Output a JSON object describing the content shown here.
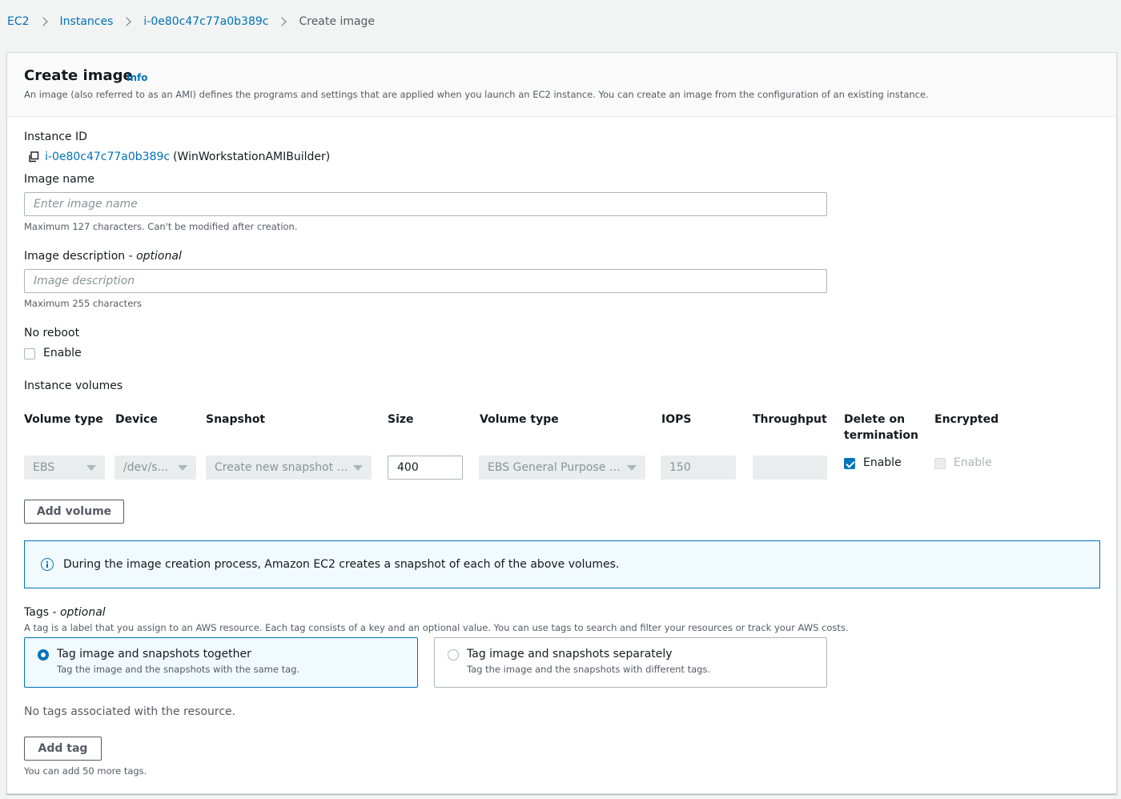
{
  "breadcrumb": {
    "items": [
      "EC2",
      "Instances",
      "i-0e80c47c77a0b389c"
    ],
    "current": "Create image"
  },
  "header": {
    "title": "Create image",
    "info": "Info",
    "description": "An image (also referred to as an AMI) defines the programs and settings that are applied when you launch an EC2 instance. You can create an image from the configuration of an existing instance."
  },
  "instance": {
    "label": "Instance ID",
    "id": "i-0e80c47c77a0b389c",
    "name": "(WinWorkstationAMIBuilder)"
  },
  "image_name": {
    "label": "Image name",
    "placeholder": "Enter image name",
    "hint": "Maximum 127 characters. Can't be modified after creation."
  },
  "image_description": {
    "label": "Image description - ",
    "label_optional": "optional",
    "placeholder": "Image description",
    "hint": "Maximum 255 characters"
  },
  "no_reboot": {
    "label": "No reboot",
    "checkbox_label": "Enable",
    "checked": false
  },
  "volumes": {
    "label": "Instance volumes",
    "columns": [
      "Volume type",
      "Device",
      "Snapshot",
      "Size",
      "Volume type",
      "IOPS",
      "Throughput",
      "Delete on termination",
      "Encrypted"
    ],
    "row": {
      "volume_type": "EBS",
      "device": "/dev/s...",
      "snapshot": "Create new snapshot fr...",
      "size": "400",
      "ebs_volume_type": "EBS General Purpose SS...",
      "iops": "150",
      "throughput": "",
      "delete_on_termination": "Enable",
      "encrypted": "Enable"
    },
    "add_button": "Add volume"
  },
  "info_alert": "During the image creation process, Amazon EC2 creates a snapshot of each of the above volumes.",
  "tags": {
    "label": "Tags - ",
    "label_optional": "optional",
    "description": "A tag is a label that you assign to an AWS resource. Each tag consists of a key and an optional value. You can use tags to search and filter your resources or track your AWS costs.",
    "options": [
      {
        "title": "Tag image and snapshots together",
        "desc": "Tag the image and the snapshots with the same tag.",
        "selected": true
      },
      {
        "title": "Tag image and snapshots separately",
        "desc": "Tag the image and the snapshots with different tags.",
        "selected": false
      }
    ],
    "empty_text": "No tags associated with the resource.",
    "add_button": "Add tag",
    "limit_hint": "You can add 50 more tags."
  },
  "colors": {
    "link": "#0073bb",
    "background": "#f2f3f3",
    "text": "#16191f",
    "muted": "#545b64"
  },
  "icons": [
    "chevron-right-icon",
    "copy-icon",
    "caret-down-icon",
    "info-icon",
    "checkbox-icon",
    "radio-icon"
  ]
}
